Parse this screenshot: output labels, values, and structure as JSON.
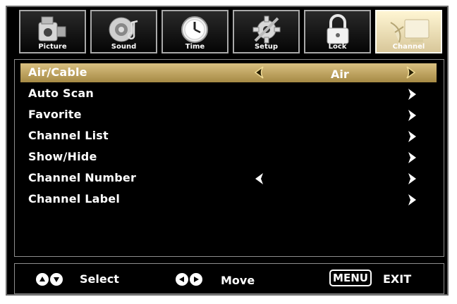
{
  "tabs": [
    {
      "label": "Picture",
      "icon": "camera-icon",
      "active": false
    },
    {
      "label": "Sound",
      "icon": "speaker-icon",
      "active": false
    },
    {
      "label": "Time",
      "icon": "clock-icon",
      "active": false
    },
    {
      "label": "Setup",
      "icon": "gear-icon",
      "active": false
    },
    {
      "label": "Lock",
      "icon": "lock-icon",
      "active": false
    },
    {
      "label": "Channel",
      "icon": "satellite-dish-icon",
      "active": true
    }
  ],
  "menu": {
    "items": [
      {
        "label": "Air/Cable",
        "value": "Air",
        "selected": true
      },
      {
        "label": "Auto Scan"
      },
      {
        "label": "Favorite"
      },
      {
        "label": "Channel List"
      },
      {
        "label": "Show/Hide"
      },
      {
        "label": "Channel Number"
      },
      {
        "label": "Channel Label"
      }
    ]
  },
  "footer": {
    "select_label": "Select",
    "move_label": "Move",
    "menu_key": "MENU",
    "exit_label": "EXIT"
  },
  "colors": {
    "selected_row": "#c8ac62",
    "selector_arrow": "#e9d08a",
    "text": "#ffffff",
    "background": "#000000"
  }
}
